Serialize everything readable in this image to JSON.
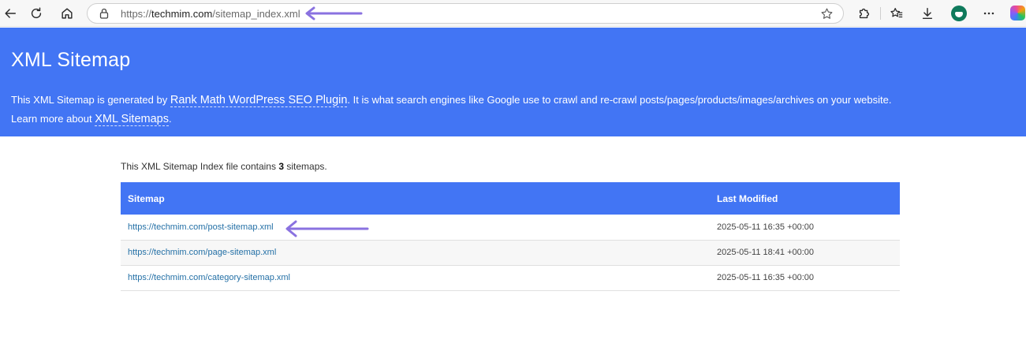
{
  "browser": {
    "url_prefix": "https://",
    "url_domain": "techmim.com",
    "url_path": "/sitemap_index.xml"
  },
  "header": {
    "title": "XML Sitemap",
    "desc_part1": "This XML Sitemap is generated by ",
    "plugin_link": "Rank Math WordPress SEO Plugin",
    "desc_part2": ". It is what search engines like Google use to crawl and re-crawl posts/pages/products/images/archives on your website.",
    "desc_part3": "Learn more about ",
    "sitemaps_link": "XML Sitemaps",
    "desc_part4": "."
  },
  "summary": {
    "prefix": "This XML Sitemap Index file contains ",
    "count": "3",
    "suffix": " sitemaps."
  },
  "table": {
    "col_sitemap": "Sitemap",
    "col_modified": "Last Modified",
    "rows": [
      {
        "url": "https://techmim.com/post-sitemap.xml",
        "modified": "2025-05-11 16:35 +00:00"
      },
      {
        "url": "https://techmim.com/page-sitemap.xml",
        "modified": "2025-05-11 18:41 +00:00"
      },
      {
        "url": "https://techmim.com/category-sitemap.xml",
        "modified": "2025-05-11 16:35 +00:00"
      }
    ]
  },
  "colors": {
    "accent": "#4275f4",
    "link": "#2470a6",
    "annotation_arrow": "#8a72e0"
  },
  "icons": [
    "back-icon",
    "refresh-icon",
    "home-icon",
    "lock-icon",
    "star-icon",
    "extensions-icon",
    "favorites-icon",
    "download-icon",
    "profile-icon",
    "more-icon",
    "copilot-icon",
    "arrow-annotation-icon"
  ]
}
